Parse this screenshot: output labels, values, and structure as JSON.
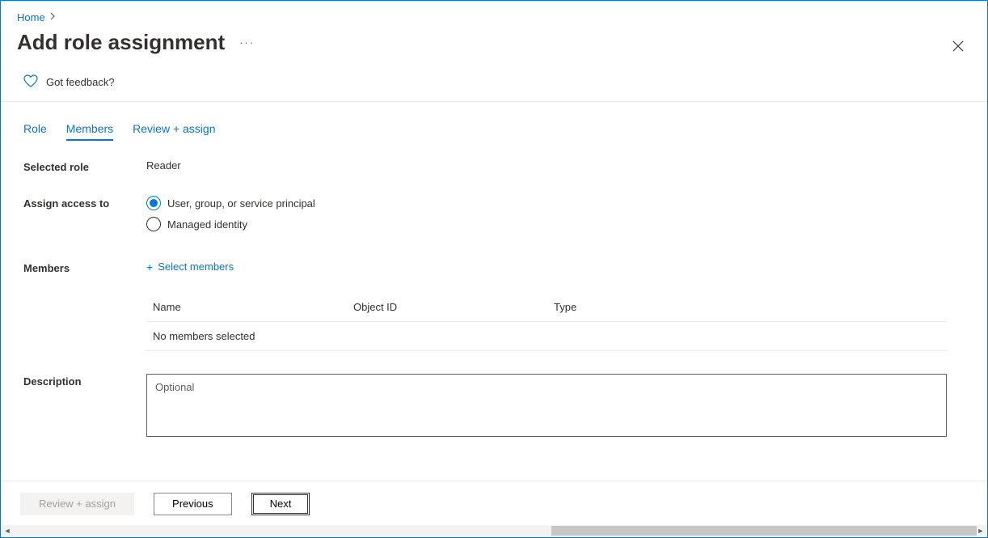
{
  "breadcrumb": {
    "home": "Home"
  },
  "title": "Add role assignment",
  "ellipsis": "···",
  "feedback": {
    "label": "Got feedback?"
  },
  "tabs": {
    "role": "Role",
    "members": "Members",
    "review": "Review + assign"
  },
  "form": {
    "selected_role_label": "Selected role",
    "selected_role_value": "Reader",
    "assign_label": "Assign access to",
    "assign_option1": "User, group, or service principal",
    "assign_option2": "Managed identity",
    "members_label": "Members",
    "select_members_link": "Select members",
    "table": {
      "col_name": "Name",
      "col_objid": "Object ID",
      "col_type": "Type",
      "empty": "No members selected"
    },
    "description_label": "Description",
    "description_placeholder": "Optional"
  },
  "footer": {
    "review": "Review + assign",
    "previous": "Previous",
    "next": "Next"
  }
}
